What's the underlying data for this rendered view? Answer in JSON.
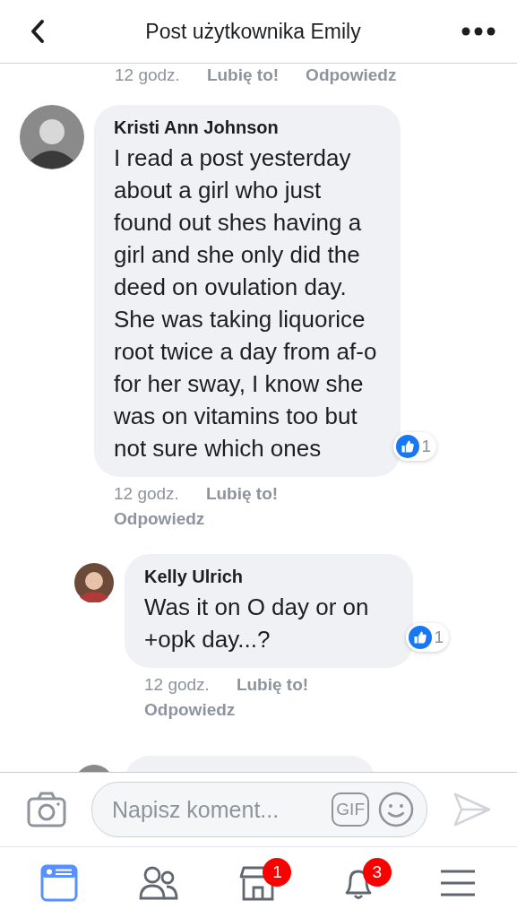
{
  "header": {
    "title": "Post użytkownika Emily"
  },
  "previous_actions": {
    "time": "12 godz.",
    "like": "Lubię to!",
    "reply": "Odpowiedz"
  },
  "comments": [
    {
      "author": "Kristi Ann Johnson",
      "text": "I read a post yesterday about a girl who just found out shes having a girl and she only did the deed on ovulation day. She was taking liquorice root twice a day from af-o for her sway, I know she was on vitamins too but not sure which ones",
      "likes": "1",
      "time": "12 godz.",
      "like": "Lubię to!",
      "reply": "Odpowiedz",
      "children": [
        {
          "author": "Kelly Ulrich",
          "text": "Was it on O day or on +opk day...?",
          "likes": "1",
          "time": "12 godz.",
          "like": "Lubię to!",
          "reply": "Odpowiedz"
        }
      ]
    }
  ],
  "composer": {
    "placeholder": "Napisz koment...",
    "gif": "GIF"
  },
  "nav": [
    {
      "kind": "feed",
      "selected": true
    },
    {
      "kind": "friends",
      "selected": false
    },
    {
      "kind": "market",
      "selected": false,
      "badge": "1"
    },
    {
      "kind": "bell",
      "selected": false,
      "badge": "3"
    },
    {
      "kind": "menu",
      "selected": false
    }
  ]
}
